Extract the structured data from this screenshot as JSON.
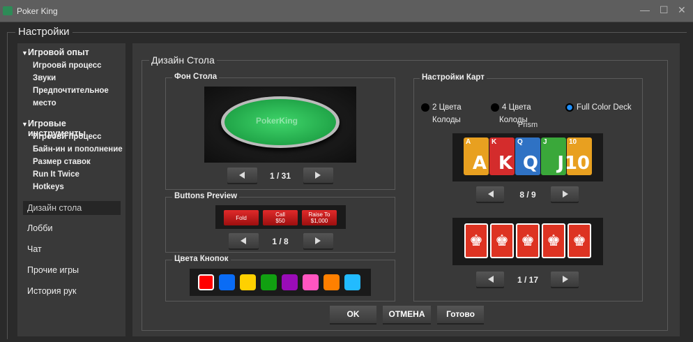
{
  "window": {
    "title": "Poker King",
    "minimize": "—",
    "maximize": "☐",
    "close": "✕"
  },
  "settings_title": "Настройки",
  "sidebar": {
    "group1": {
      "label": "Игровой опыт",
      "items": [
        "Игроовй процесс",
        "Звуки",
        "Предпочтительное",
        "место"
      ]
    },
    "group2": {
      "label": "Игровые инструменты",
      "items": [
        "Игроовй процесс",
        "Байн-ин и пополнение",
        "Размер ставок",
        "Run It Twice",
        "Hotkeys"
      ]
    },
    "items": [
      "Дизайн стола",
      "Лобби",
      "Чат",
      "Прочие игры",
      "История рук"
    ]
  },
  "main": {
    "title": "Дизайн Стола",
    "table_bg": {
      "label": "Фон Стола",
      "logo": "PokerKing",
      "counter": "1 / 31"
    },
    "buttons_preview": {
      "label": "Buttons Preview",
      "fold": "Fold",
      "call": "Call",
      "call_amount": "$50",
      "raise": "Raise To",
      "raise_amount": "$1,000",
      "counter": "1 / 8"
    },
    "button_colors": {
      "label": "Цвета Кнопок",
      "colors": [
        "#ff0000",
        "#0a6cf5",
        "#ffd000",
        "#11a011",
        "#9a0cb8",
        "#ff55c0",
        "#ff8000",
        "#22bbff"
      ]
    },
    "cards": {
      "label": "Настройки Карт",
      "options": [
        {
          "l1": "2 Цвета",
          "l2": "Колоды"
        },
        {
          "l1": "4 Цвета",
          "l2": "Колоды"
        },
        {
          "l1": "Full Color Deck",
          "l2": ""
        }
      ],
      "selected_option": 2,
      "deck_name": "Prism",
      "deck": [
        {
          "rank": "A",
          "color": "#e8a020"
        },
        {
          "rank": "K",
          "color": "#d42c2c"
        },
        {
          "rank": "Q",
          "color": "#2f72c4"
        },
        {
          "rank": "J",
          "color": "#3aa83a"
        },
        {
          "rank": "10",
          "color": "#e8a020"
        }
      ],
      "deck_counter": "8 / 9",
      "back_counter": "1 / 17",
      "back_glyph": "♚"
    }
  },
  "footer": {
    "ok": "OK",
    "cancel": "ОТМЕНА",
    "done": "Готово"
  }
}
